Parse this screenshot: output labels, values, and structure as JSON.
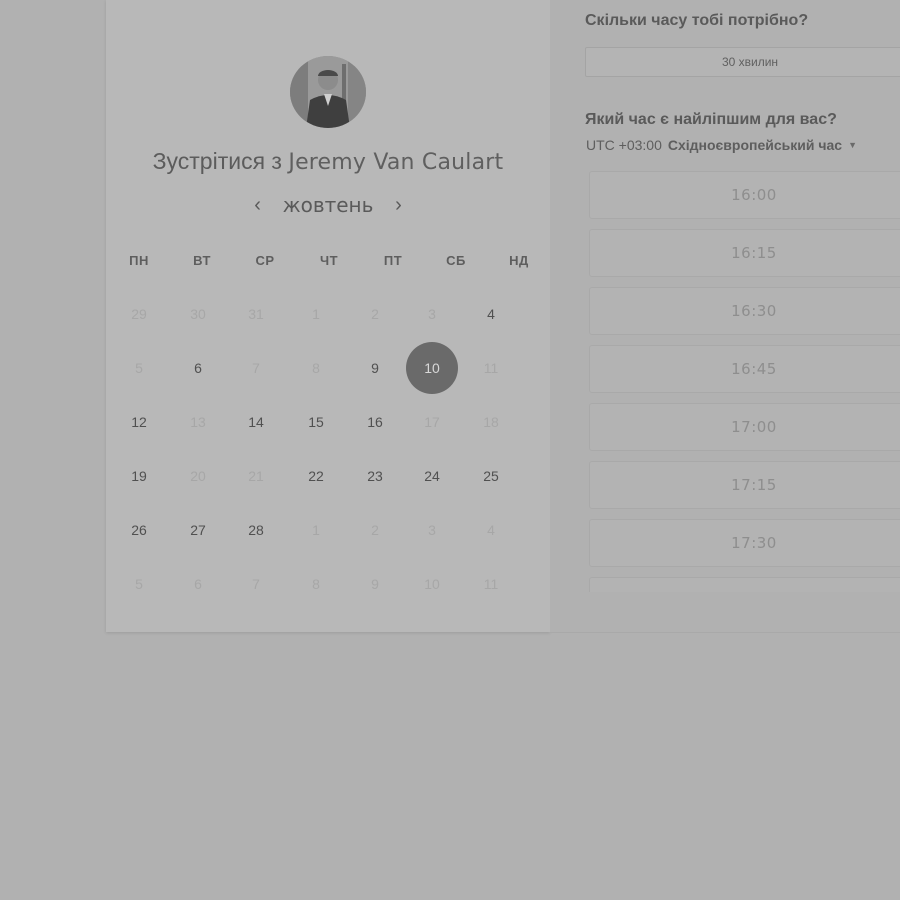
{
  "host": {
    "title_prefix": "Зустрітися з",
    "name": "Jeremy Van Caulart"
  },
  "calendar": {
    "month": "жовтень",
    "prev_icon": "‹",
    "next_icon": "›",
    "weekdays": [
      "ПН",
      "ВТ",
      "СР",
      "ЧТ",
      "ПТ",
      "СБ",
      "НД"
    ],
    "weeks": [
      [
        {
          "d": "29",
          "s": "muted"
        },
        {
          "d": "30",
          "s": "muted"
        },
        {
          "d": "31",
          "s": "muted"
        },
        {
          "d": "1",
          "s": "muted"
        },
        {
          "d": "2",
          "s": "muted"
        },
        {
          "d": "3",
          "s": "muted"
        },
        {
          "d": "4",
          "s": "active"
        }
      ],
      [
        {
          "d": "5",
          "s": "muted"
        },
        {
          "d": "6",
          "s": "active"
        },
        {
          "d": "7",
          "s": "muted"
        },
        {
          "d": "8",
          "s": "muted"
        },
        {
          "d": "9",
          "s": "active"
        },
        {
          "d": "10",
          "s": "selected"
        },
        {
          "d": "11",
          "s": "muted"
        }
      ],
      [
        {
          "d": "12",
          "s": "active"
        },
        {
          "d": "13",
          "s": "muted"
        },
        {
          "d": "14",
          "s": "active"
        },
        {
          "d": "15",
          "s": "active"
        },
        {
          "d": "16",
          "s": "active"
        },
        {
          "d": "17",
          "s": "muted"
        },
        {
          "d": "18",
          "s": "muted"
        }
      ],
      [
        {
          "d": "19",
          "s": "active"
        },
        {
          "d": "20",
          "s": "muted"
        },
        {
          "d": "21",
          "s": "muted"
        },
        {
          "d": "22",
          "s": "active"
        },
        {
          "d": "23",
          "s": "active"
        },
        {
          "d": "24",
          "s": "active"
        },
        {
          "d": "25",
          "s": "active"
        }
      ],
      [
        {
          "d": "26",
          "s": "active"
        },
        {
          "d": "27",
          "s": "active"
        },
        {
          "d": "28",
          "s": "active"
        },
        {
          "d": "1",
          "s": "muted"
        },
        {
          "d": "2",
          "s": "muted"
        },
        {
          "d": "3",
          "s": "muted"
        },
        {
          "d": "4",
          "s": "muted"
        }
      ],
      [
        {
          "d": "5",
          "s": "muted"
        },
        {
          "d": "6",
          "s": "muted"
        },
        {
          "d": "7",
          "s": "muted"
        },
        {
          "d": "8",
          "s": "muted"
        },
        {
          "d": "9",
          "s": "muted"
        },
        {
          "d": "10",
          "s": "muted"
        },
        {
          "d": "11",
          "s": "muted"
        }
      ]
    ]
  },
  "duration": {
    "heading": "Скільки часу тобі потрібно?",
    "value": "30 хвилин"
  },
  "time": {
    "heading": "Який час є найліпшим для вас?",
    "tz_offset": "UTC +03:00",
    "tz_name": "Східноєвропейський час",
    "tz_caret_icon": "▼",
    "slots": [
      "16:00",
      "16:15",
      "16:30",
      "16:45",
      "17:00",
      "17:15",
      "17:30"
    ]
  },
  "colors": {
    "overlay_bg": "#b1b1b1",
    "selected_day": "#6a6a6a"
  }
}
